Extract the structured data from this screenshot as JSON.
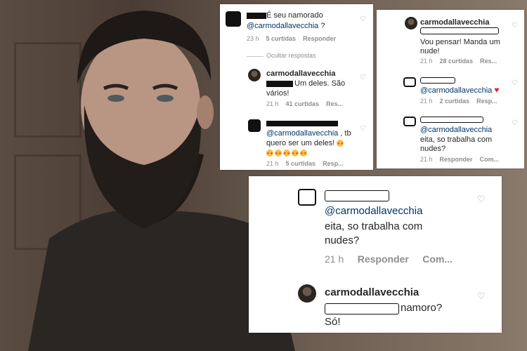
{
  "card1": {
    "c1": {
      "text": "É seu namorado",
      "mention": "@carmodallavecchia",
      "suffix": " ?",
      "time": "23 h",
      "likes": "5 curtidas",
      "reply": "Responder"
    },
    "hide_replies": "Ocultar respostas",
    "c2": {
      "user": "carmodallavecchia",
      "text": "Um deles. São",
      "text2": "vários!",
      "time": "21 h",
      "likes": "41 curtidas",
      "reply": "Res..."
    },
    "c3": {
      "mention": "@carmodallavecchia",
      "text": " , tb",
      "text2": "quero ser um deles!",
      "time": "21 h",
      "likes": "5 curtidas",
      "reply": "Resp..."
    }
  },
  "card2": {
    "c1": {
      "user": "carmodallavecchia",
      "text": "Vou pensar! Manda um",
      "text2": "nude!",
      "time": "21 h",
      "likes": "28 curtidas",
      "reply": "Res..."
    },
    "c2": {
      "mention": "@carmodallavecchia",
      "time": "21 h",
      "likes": "2 curtidas",
      "reply": "Resp..."
    },
    "c3": {
      "mention": "@carmodallavecchia",
      "text": "eita, so trabalha com",
      "text2": "nudes?",
      "time": "21 h",
      "reply": "Responder",
      "more": "Com..."
    }
  },
  "card3": {
    "c1": {
      "mention": "@carmodallavecchia",
      "text": "eita, so trabalha com",
      "text2": "nudes?",
      "time": "21 h",
      "reply": "Responder",
      "more": "Com..."
    },
    "c2": {
      "user": "carmodallavecchia",
      "text": "namoro?",
      "text2": "Só!"
    }
  },
  "icons": {
    "like": "heart-outline-icon",
    "red_heart": "red-heart-emoji",
    "emoji": "heart-eyes-emoji"
  }
}
